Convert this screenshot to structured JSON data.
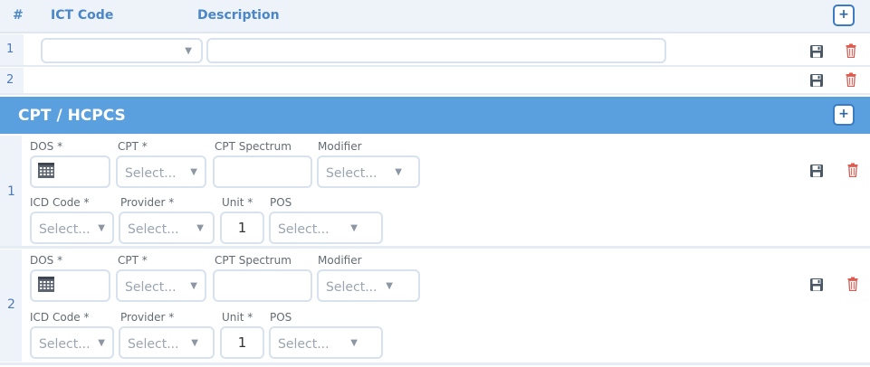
{
  "ict": {
    "headers": {
      "num": "#",
      "code": "ICT Code",
      "description": "Description"
    },
    "add_label": "+",
    "rows": [
      {
        "num": "1"
      },
      {
        "num": "2"
      }
    ]
  },
  "cpt": {
    "title": "CPT / HCPCS",
    "add_label": "+",
    "labels": {
      "dos": "DOS *",
      "cpt": "CPT *",
      "spectrum": "CPT Spectrum",
      "modifier": "Modifier",
      "icd": "ICD Code *",
      "provider": "Provider *",
      "unit": "Unit *",
      "pos": "POS"
    },
    "placeholder": "Select...",
    "rows": [
      {
        "num": "1",
        "unit": "1"
      },
      {
        "num": "2",
        "unit": "1"
      }
    ]
  },
  "icons": [
    "save-icon",
    "trash-icon",
    "calendar-icon",
    "chevron-down-icon"
  ],
  "colors": {
    "accent": "#5a9fde",
    "header_text": "#4a86c8",
    "delete": "#e05a4f",
    "save": "#4a5866"
  }
}
